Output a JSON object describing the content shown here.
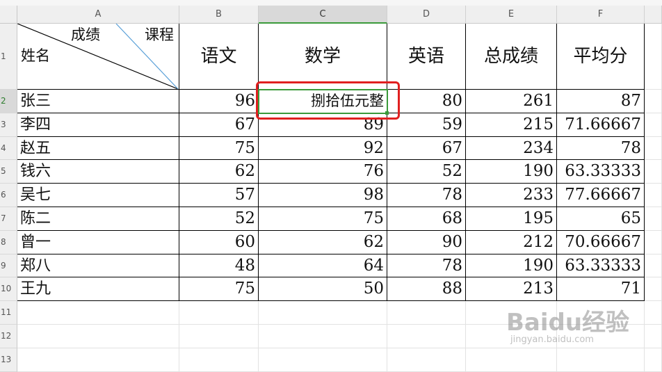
{
  "columns": [
    "A",
    "B",
    "C",
    "D",
    "E",
    "F"
  ],
  "row_numbers": [
    "1",
    "2",
    "3",
    "4",
    "5",
    "6",
    "7",
    "8",
    "9",
    "10",
    "11",
    "12",
    "13"
  ],
  "diag_header": {
    "top_left": "成绩",
    "top_right": "课程",
    "bottom": "姓名"
  },
  "headers": [
    "语文",
    "数学",
    "英语",
    "总成绩",
    "平均分"
  ],
  "rows": [
    {
      "name": "张三",
      "chinese": "96",
      "math": "捌拾伍元整",
      "english": "80",
      "total": "261",
      "avg": "87"
    },
    {
      "name": "李四",
      "chinese": "67",
      "math": "89",
      "english": "59",
      "total": "215",
      "avg": "71.66667"
    },
    {
      "name": "赵五",
      "chinese": "75",
      "math": "92",
      "english": "67",
      "total": "234",
      "avg": "78"
    },
    {
      "name": "钱六",
      "chinese": "62",
      "math": "76",
      "english": "52",
      "total": "190",
      "avg": "63.33333"
    },
    {
      "name": "吴七",
      "chinese": "57",
      "math": "98",
      "english": "78",
      "total": "233",
      "avg": "77.66667"
    },
    {
      "name": "陈二",
      "chinese": "52",
      "math": "75",
      "english": "68",
      "total": "195",
      "avg": "65"
    },
    {
      "name": "曾一",
      "chinese": "60",
      "math": "62",
      "english": "90",
      "total": "212",
      "avg": "70.66667"
    },
    {
      "name": "郑八",
      "chinese": "48",
      "math": "64",
      "english": "78",
      "total": "190",
      "avg": "63.33333"
    },
    {
      "name": "王九",
      "chinese": "75",
      "math": "50",
      "english": "88",
      "total": "213",
      "avg": "71"
    }
  ],
  "watermark": {
    "brand": "Baidu经验",
    "url": "jingyan.baidu.com"
  },
  "colors": {
    "selection": "#3a9a3a",
    "highlight_box": "#e02020",
    "diag_line_left": "#000000",
    "diag_line_right": "#5aa0d8"
  }
}
